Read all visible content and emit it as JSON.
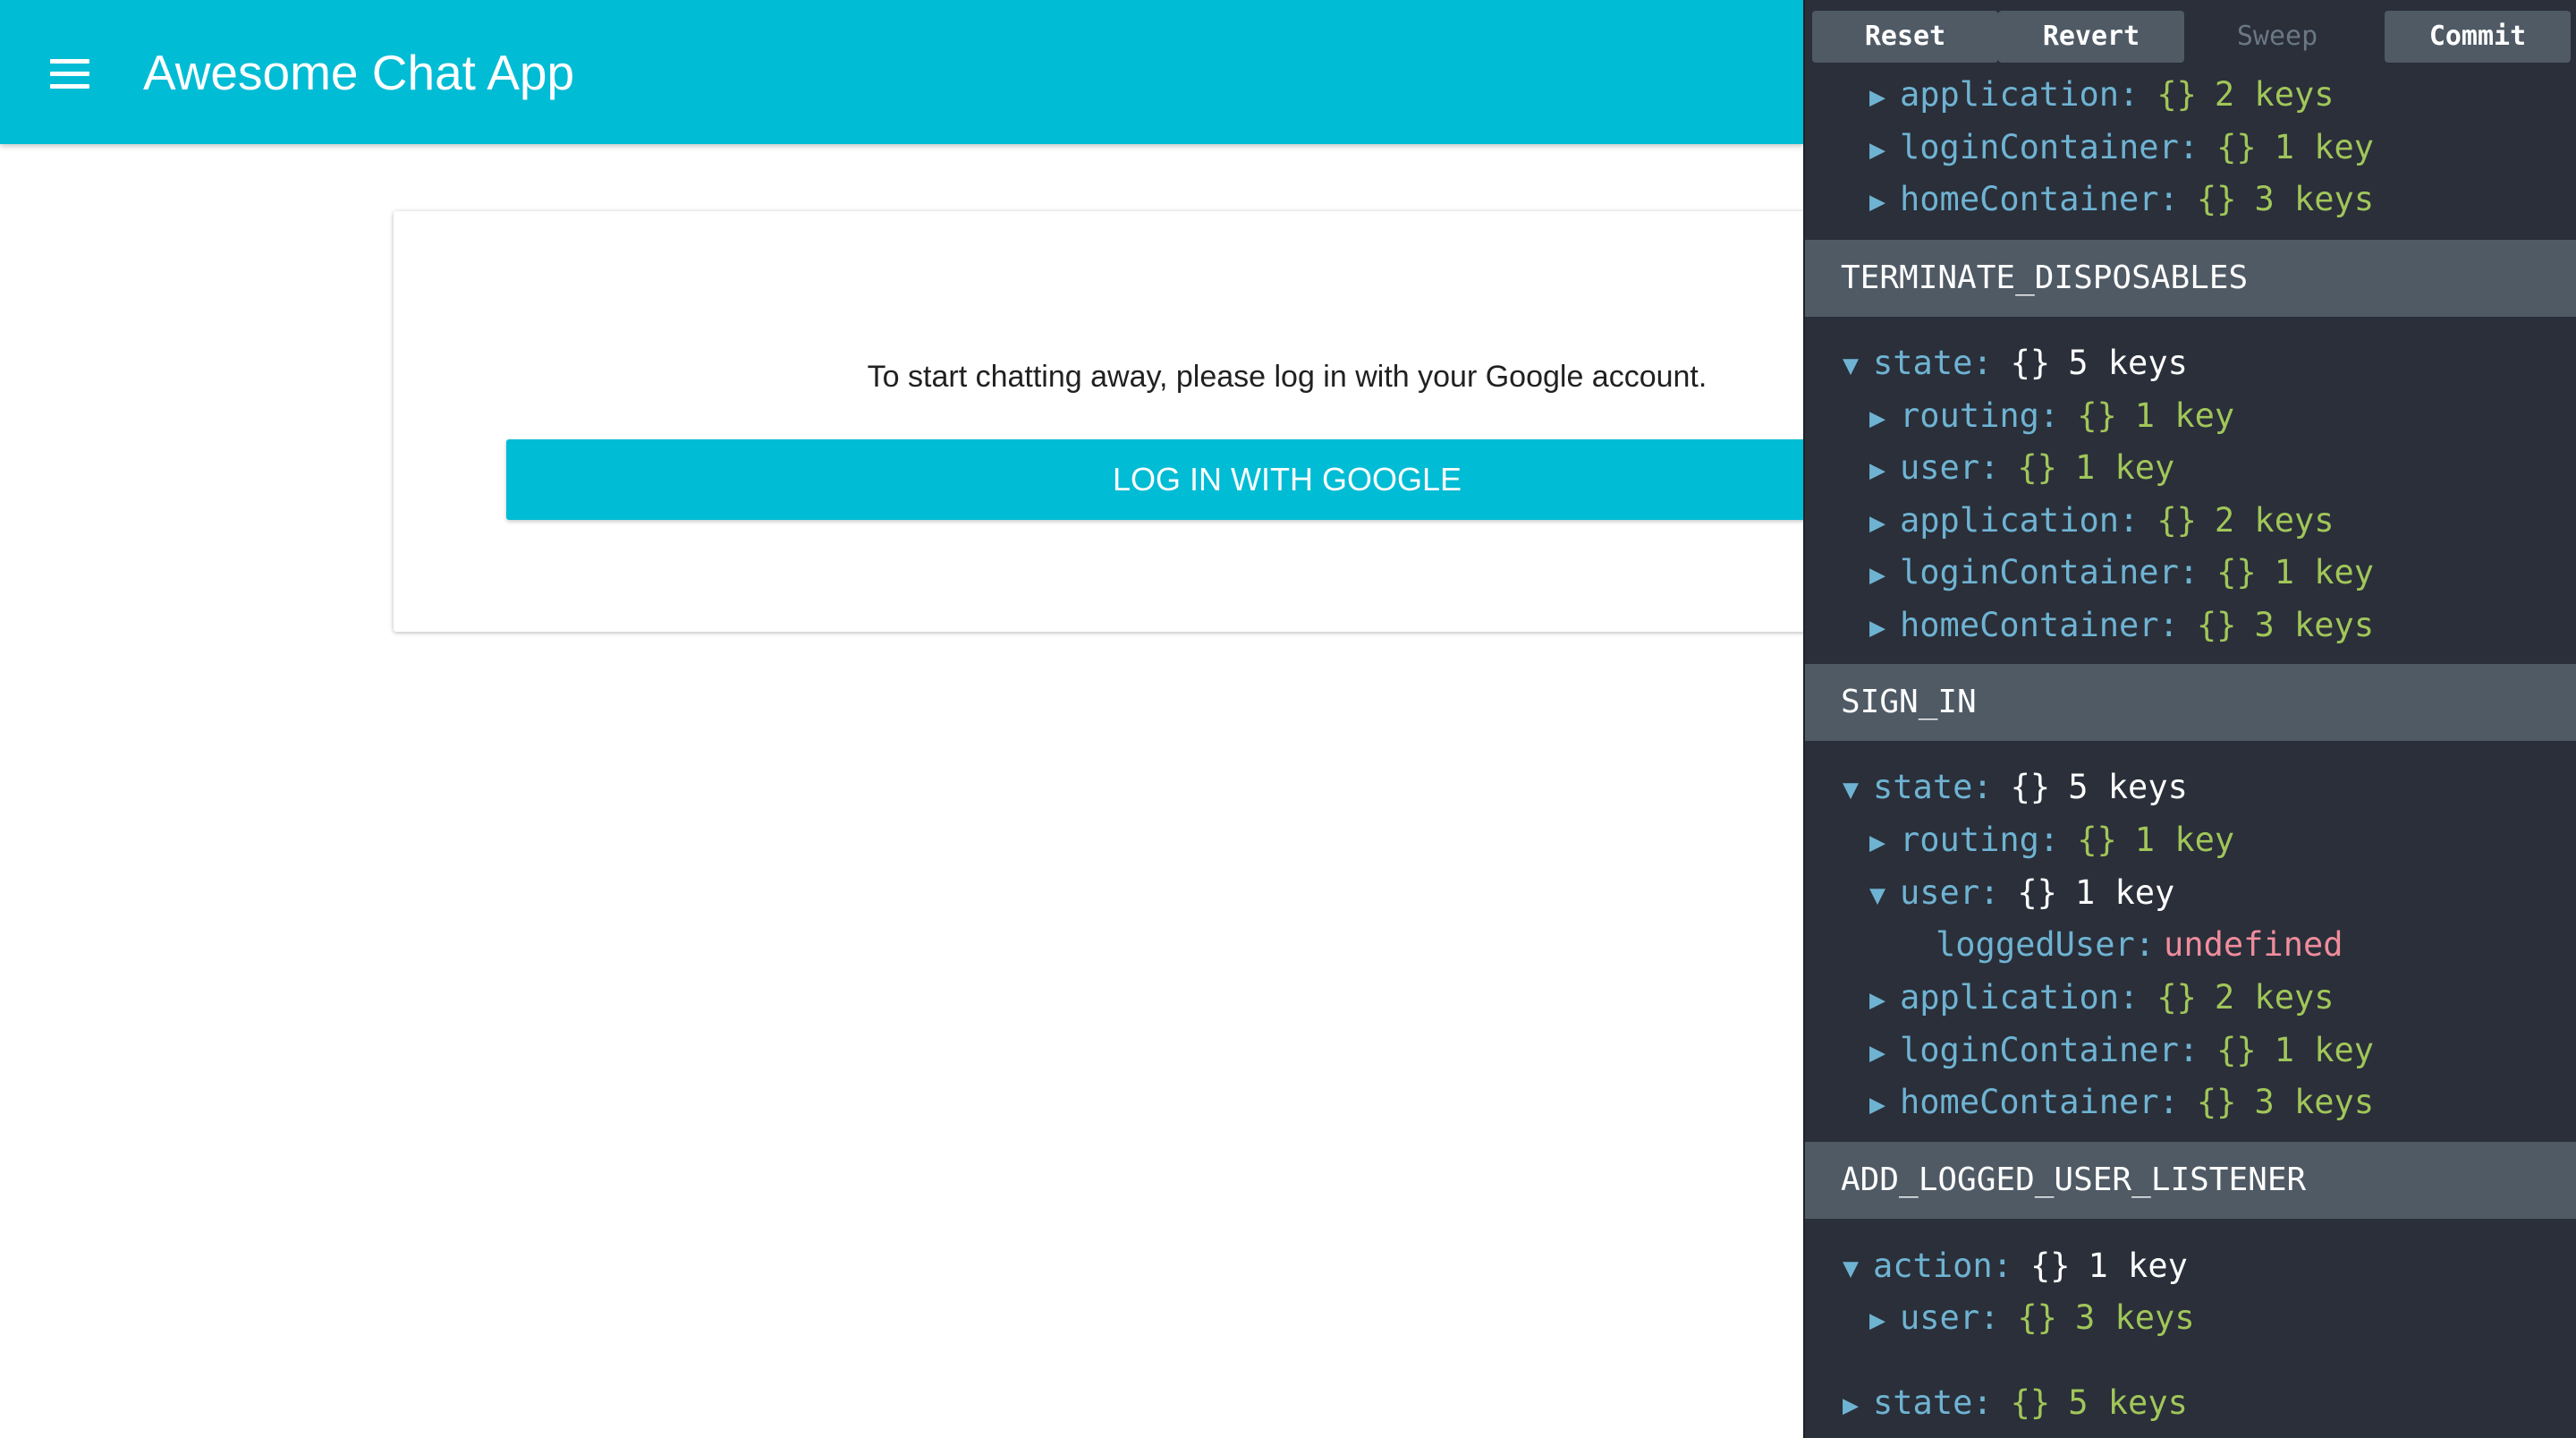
{
  "app": {
    "title": "Awesome Chat App",
    "login_message": "To start chatting away, please log in with your Google account.",
    "login_button": "LOG IN WITH GOOGLE",
    "colors": {
      "primary": "#00bcd4"
    }
  },
  "devtools": {
    "toolbar": {
      "reset": "Reset",
      "revert": "Revert",
      "sweep": "Sweep",
      "commit": "Commit"
    },
    "top_rows": [
      {
        "key": "application:",
        "brace": "{}",
        "count": "2 keys"
      },
      {
        "key": "loginContainer:",
        "brace": "{}",
        "count": "1 key"
      },
      {
        "key": "homeContainer:",
        "brace": "{}",
        "count": "3 keys"
      }
    ],
    "actions": [
      {
        "name": "TERMINATE_DISPOSABLES",
        "state": {
          "key": "state:",
          "brace": "{}",
          "count": "5 keys"
        },
        "children": [
          {
            "key": "routing:",
            "brace": "{}",
            "count": "1 key"
          },
          {
            "key": "user:",
            "brace": "{}",
            "count": "1 key"
          },
          {
            "key": "application:",
            "brace": "{}",
            "count": "2 keys"
          },
          {
            "key": "loginContainer:",
            "brace": "{}",
            "count": "1 key"
          },
          {
            "key": "homeContainer:",
            "brace": "{}",
            "count": "3 keys"
          }
        ]
      },
      {
        "name": "SIGN_IN",
        "state": {
          "key": "state:",
          "brace": "{}",
          "count": "5 keys"
        },
        "children": [
          {
            "key": "routing:",
            "brace": "{}",
            "count": "1 key"
          },
          {
            "key": "user:",
            "brace": "{}",
            "count": "1 key"
          },
          {
            "key": "loggedUser:",
            "value": "undefined"
          },
          {
            "key": "application:",
            "brace": "{}",
            "count": "2 keys"
          },
          {
            "key": "loginContainer:",
            "brace": "{}",
            "count": "1 key"
          },
          {
            "key": "homeContainer:",
            "brace": "{}",
            "count": "3 keys"
          }
        ]
      },
      {
        "name": "ADD_LOGGED_USER_LISTENER",
        "action": {
          "key": "action:",
          "brace": "{}",
          "count": "1 key"
        },
        "action_children": [
          {
            "key": "user:",
            "brace": "{}",
            "count": "3 keys"
          }
        ],
        "state": {
          "key": "state:",
          "brace": "{}",
          "count": "5 keys"
        }
      }
    ],
    "icons": {
      "expanded": "triangle-down-icon",
      "collapsed": "triangle-right-icon"
    },
    "colors": {
      "background": "#2a2f3a",
      "header": "#4f5a65",
      "key": "#6fb3d2",
      "meta": "#a1c659",
      "undefined": "#f08c9c"
    }
  }
}
